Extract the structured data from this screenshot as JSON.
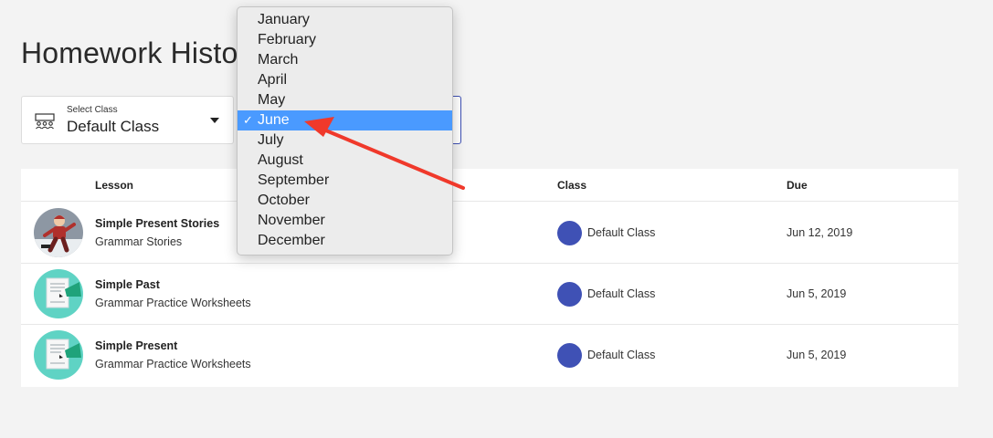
{
  "page": {
    "title": "Homework History"
  },
  "class_select": {
    "label": "Select Class",
    "value": "Default Class"
  },
  "table": {
    "headers": {
      "lesson": "Lesson",
      "class": "Class",
      "due": "Due"
    },
    "rows": [
      {
        "title": "Simple Present Stories",
        "subtitle": "Grammar Stories",
        "class": "Default Class",
        "due": "Jun 12, 2019",
        "thumb": "story-character-icon"
      },
      {
        "title": "Simple Past",
        "subtitle": "Grammar Practice Worksheets",
        "class": "Default Class",
        "due": "Jun 5, 2019",
        "thumb": "worksheet-icon"
      },
      {
        "title": "Simple Present",
        "subtitle": "Grammar Practice Worksheets",
        "class": "Default Class",
        "due": "Jun 5, 2019",
        "thumb": "worksheet-icon"
      }
    ]
  },
  "month_dropdown": {
    "selected": "June",
    "check": "✓",
    "options": [
      "January",
      "February",
      "March",
      "April",
      "May",
      "June",
      "July",
      "August",
      "September",
      "October",
      "November",
      "December"
    ]
  },
  "colors": {
    "accent": "#3f51b5",
    "selected_bg": "#4a9aff",
    "annotation_arrow": "#f0392b",
    "thumb_teal": "#5fd3c4"
  }
}
